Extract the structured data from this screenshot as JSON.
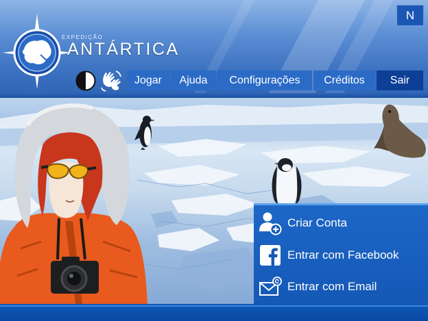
{
  "brand": {
    "subtitle": "EXPEDIÇÃO",
    "title": "ANTÁRTICA"
  },
  "language": {
    "label": "N"
  },
  "nav": {
    "items": [
      {
        "label": "Jogar"
      },
      {
        "label": "Ajuda"
      },
      {
        "label": "Configurações"
      },
      {
        "label": "Créditos"
      },
      {
        "label": "Sair"
      }
    ]
  },
  "account": {
    "create": "Criar Conta",
    "facebook": "Entrar com Facebook",
    "email": "Entrar com Email"
  },
  "icons": {
    "logo": "compass-logo-icon",
    "contrast": "contrast-icon",
    "libras": "sign-language-icon",
    "create": "add-user-icon",
    "facebook": "facebook-icon",
    "email": "email-icon"
  },
  "colors": {
    "header": "#3d73c2",
    "nav": "#2b6bc6",
    "nav_active": "#0d3f96",
    "panel": "#1558b6",
    "parka": "#e85a1e"
  }
}
